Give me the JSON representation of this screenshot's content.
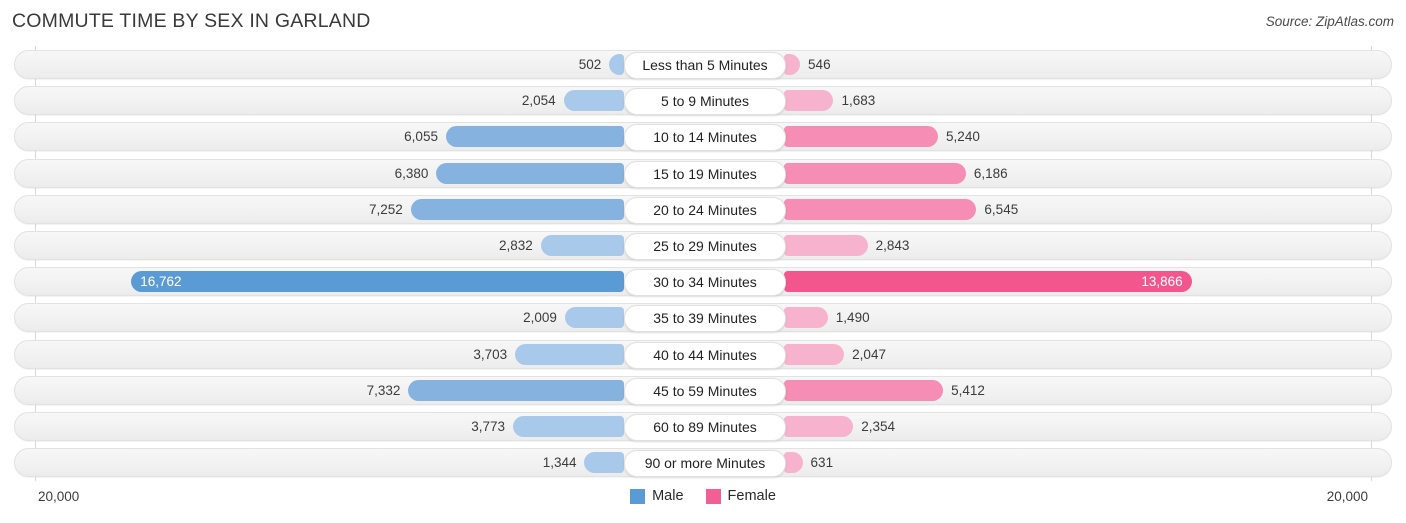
{
  "header": {
    "title": "COMMUTE TIME BY SEX IN GARLAND",
    "source": "Source: ZipAtlas.com"
  },
  "axis": {
    "left_tick": "20,000",
    "right_tick": "20,000",
    "max": 20000
  },
  "legend": {
    "items": [
      {
        "label": "Male",
        "color": "#5b9bd5"
      },
      {
        "label": "Female",
        "color": "#f25f94"
      }
    ]
  },
  "colors": {
    "male_light": "#a9c9ea",
    "male_mid": "#86b2e0",
    "male_strong": "#5b9bd5",
    "female_light": "#f7b3cd",
    "female_mid": "#f58db4",
    "female_strong": "#f2568d",
    "row_track": "#f2f2f2",
    "axis_line": "#d8d8d8"
  },
  "chart_data": {
    "type": "bar",
    "orientation": "horizontal-diverging",
    "title": "COMMUTE TIME BY SEX IN GARLAND",
    "xlabel": "",
    "ylabel": "",
    "xlim": [
      -20000,
      20000
    ],
    "grid": false,
    "legend_position": "bottom-center",
    "categories": [
      "Less than 5 Minutes",
      "5 to 9 Minutes",
      "10 to 14 Minutes",
      "15 to 19 Minutes",
      "20 to 24 Minutes",
      "25 to 29 Minutes",
      "30 to 34 Minutes",
      "35 to 39 Minutes",
      "40 to 44 Minutes",
      "45 to 59 Minutes",
      "60 to 89 Minutes",
      "90 or more Minutes"
    ],
    "series": [
      {
        "name": "Male",
        "side": "left",
        "values": [
          502,
          2054,
          6055,
          6380,
          7252,
          2832,
          16762,
          2009,
          3703,
          7332,
          3773,
          1344
        ],
        "labels": [
          "502",
          "2,054",
          "6,055",
          "6,380",
          "7,252",
          "2,832",
          "16,762",
          "2,009",
          "3,703",
          "7,332",
          "3,773",
          "1,344"
        ]
      },
      {
        "name": "Female",
        "side": "right",
        "values": [
          546,
          1683,
          5240,
          6186,
          6545,
          2843,
          13866,
          1490,
          2047,
          5412,
          2354,
          631
        ],
        "labels": [
          "546",
          "1,683",
          "5,240",
          "6,186",
          "6,545",
          "2,843",
          "13,866",
          "1,490",
          "2,047",
          "5,412",
          "2,354",
          "631"
        ]
      }
    ]
  }
}
